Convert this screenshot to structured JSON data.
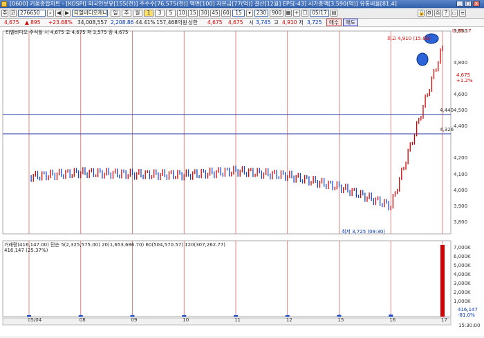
{
  "window": {
    "title": "[0600] 키움종합차트 - [KOSPI] 외국인보유[155(천)] 주수수[76,575(천)] 액면[100] 자본금[77(억)] 결산[12월] EPS[-43] 시가총액[3,590(억)] 유통비율[81.4]",
    "minimize": "_",
    "maximize": "□",
    "close": "x"
  },
  "toolbar": {
    "item_label": "주",
    "code_label": "코",
    "code_value": "276650",
    "stock_name": "티엘비디오캐니",
    "chart_label": "차트",
    "periods": [
      "일",
      "주",
      "월",
      "1",
      "3",
      "5",
      "10",
      "15",
      "30",
      "45",
      "60",
      "15"
    ],
    "tick_value": "230",
    "tick_total": "900",
    "date_value": "05/17"
  },
  "pricebar": {
    "price": "4,675",
    "change": "▲ 895",
    "rate": "+23.68%",
    "volume": "34,008,557",
    "amount": "2,208.86",
    "ratio": "44.41%",
    "turnover": "157,468억원",
    "credit_label": "상한",
    "upper": "4,675",
    "upper_lbl": "시",
    "open": "3,745",
    "high_lbl": "고",
    "high": "4,910",
    "low_lbl": "저",
    "low": "3,725",
    "buy": "매수",
    "sell": "매도"
  },
  "chart": {
    "legend": "티엘비디오 주식틀 시 4,675 고 4,675 저 3,575 종 4,675",
    "high_label": "최고 4,910 (15:00)",
    "low_label": "최저 3,725 (09:30)",
    "current_price": "4,675",
    "current_change": "+1.2%",
    "line1_price": "4,440",
    "line2_price": "4,326",
    "top_right_price": "U:35.17",
    "volume_legend": "거래량(416,147.00)  단순 5(2,325,575.00)  20(1,653,686.70)  60(504,570.57)  120(307,262.77)",
    "volume_value": "416,147 (25.37%)",
    "volume_last": "416,147",
    "volume_pct": "-81.0%",
    "time_label": "15:30:00",
    "date_labels": [
      "05/04",
      "08",
      "09",
      "10",
      "11",
      "12",
      "15",
      "16",
      "17"
    ],
    "scale_labels": [
      "5,000",
      "4,800",
      "4,600",
      "4,500",
      "4,400",
      "4,200",
      "4,100",
      "4,000",
      "3,900",
      "3,800"
    ],
    "vol_scale": [
      "7,000K",
      "6,000K",
      "5,000K",
      "4,000K",
      "3,000K",
      "2,000K",
      "1,000K"
    ]
  },
  "chart_data": {
    "type": "line",
    "title": "",
    "xlabel": "",
    "ylabel": "",
    "x": [
      "05/04",
      "08",
      "09",
      "10",
      "11",
      "12",
      "15",
      "16",
      "17"
    ],
    "series": [
      {
        "values": [
          4085,
          4110,
          4100,
          4095,
          4120,
          4090,
          4020,
          3900,
          4900
        ]
      }
    ],
    "ylim": [
      3725,
      5000
    ],
    "volume_series": {
      "name": "거래량",
      "values": [
        100000,
        150000,
        120000,
        110000,
        130000,
        120000,
        180000,
        220000,
        7500000
      ]
    }
  }
}
